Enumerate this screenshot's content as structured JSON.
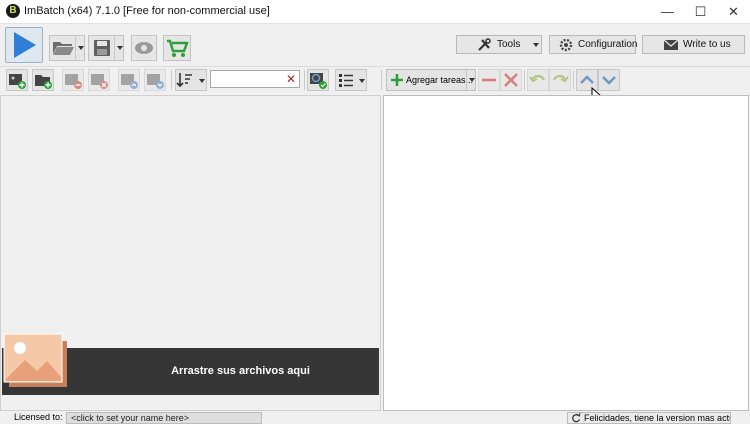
{
  "window": {
    "title": "ImBatch (x64) 7.1.0 [Free for non-commercial use]",
    "app_icon_letter": "B",
    "minimize": "—",
    "maximize": "☐",
    "close": "✕"
  },
  "main_toolbar": {
    "tools_label": "Tools",
    "configuration_label": "Configuration",
    "write_label": "Write to us"
  },
  "tasks_toolbar": {
    "add_tasks_label": "Agregar tareas..."
  },
  "file_toolbar": {
    "search_value": "",
    "search_placeholder": ""
  },
  "dropzone": {
    "text": "Arrastre sus archivos aqui"
  },
  "statusbar": {
    "license_label": "Licensed to:",
    "license_value": "<click to set your name here>",
    "update_message": "Felicidades, tiene la version mas actual"
  },
  "colors": {
    "run_blue": "#2f7fd6",
    "cart_green": "#2e9e3a",
    "add_green": "#2e9e3a",
    "remove_red": "#c0392b",
    "dropzone_bg": "#363636"
  }
}
